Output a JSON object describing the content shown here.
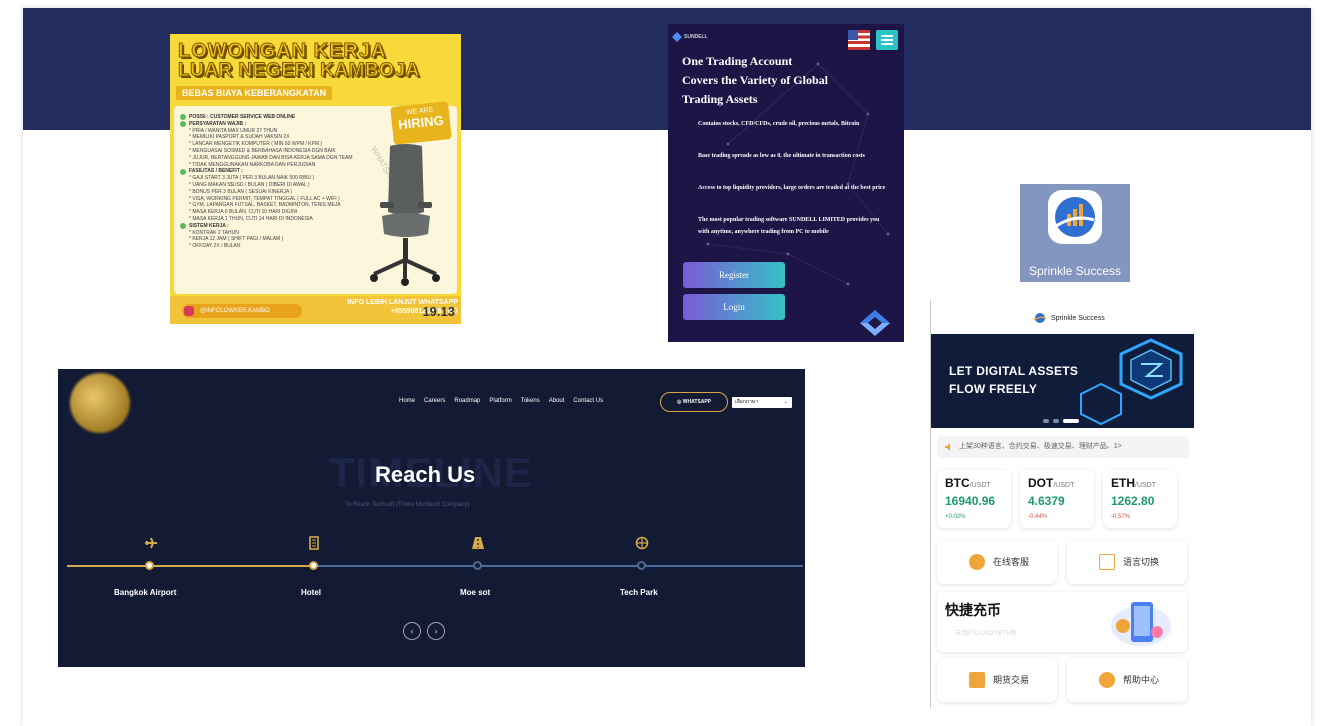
{
  "colors": {
    "band": "#222c5e",
    "poster_yellow": "#f8d93a",
    "trade_bg": "#1c1546",
    "timeline_bg": "#121a34",
    "gold": "#d3a94a",
    "green": "#1c9a6b",
    "red": "#d9534f"
  },
  "poster": {
    "title_line1": "LOWONGAN KERJA",
    "title_line2": "LUAR NEGERI KAMBOJA",
    "ribbon": "BEBAS BIAYA KEBERANGKATAN",
    "hiring_small": "WE ARE",
    "hiring_big": "HIRING",
    "watermark": "WHATSAPP",
    "sections": [
      {
        "title": "POSISI : CUSTOMER SERVICE WEB ONLINE",
        "items": []
      },
      {
        "title": "PERSYARATAN WAJIB :",
        "items": [
          "* PRIA / WANITA MAX UMUR 27 THUN",
          "* MEMILIKI PASPORT & SUDAH VAKSIN 2X",
          "* LANCAR MENGETIK KOMPUTER ( MIN 60 WPM / KPM )",
          "* MENGUASAI SOSMED & BERBAHASA INDONESIA DGN BAIK",
          "* JUJUR, BERTANGGUNG JAWAB DAN BISA KERJA SAMA DGN TEAM",
          "* TIDAK MENGGUNAKAN NARKOBA DAN PERJUDIAN"
        ]
      },
      {
        "title": "FASILITAS / BENEFIT :",
        "items": [
          "* GAJI START 3 JUTA ( PER 3 BULAN NAIK 500 RIBU )",
          "* UANG MAKAN 5$USD / BULAN ( DIBERI DI AWAL )",
          "* BONUS PER 3 BULAN ( SESUAI KINERJA )",
          "* VISA, WORKING PERMIT, TEMPAT TINGGAL ( FULL AC + WIFI )",
          "* GYM, LAPANGAN FUTSAL, BASKET, BADMINTON, TENIS MEJA",
          "* MASA KERJA 6 BULAN, CUTI 10 HARI DIGINI",
          "* MASA KERJA 1 THUN, CUTI 14 HARI DI INDONESIA"
        ]
      },
      {
        "title": "SISTEM KERJA :",
        "items": [
          "* KONTRAK 2 TAHUN",
          "* KERJA 12 JAM ( SHIFT PAGI / MALAM )",
          "* OFFDAY 2X / BULAN"
        ]
      }
    ],
    "instagram": "@INFOLOWKER.KAMBO",
    "info_line1": "INFO LEBIH LANJUT WHATSAPP",
    "info_line2": "+855968126318 | RO",
    "stamp": "19.13"
  },
  "trade": {
    "brand": "SUNDELL",
    "title_lines": [
      "One Trading Account",
      "Covers the Variety of Global",
      "Trading Assets"
    ],
    "paragraphs": [
      "Contains stocks, CFD/CFDs, crude oil, precious metals, Bitcoin",
      "Base trading spreads as low as 0, the ultimate in transaction costs",
      "Access to top liquidity providers, large orders are traded at the best price",
      "The most popular trading software SUNDELL LIMITED provides you with anytime, anywhere trading from PC to mobile"
    ],
    "register": "Register",
    "login": "Login"
  },
  "sprinkle_icon": {
    "label": "Sprinkle Success"
  },
  "sprinkle": {
    "header": "Sprinkle Success",
    "banner_line1": "LET DIGITAL ASSETS",
    "banner_line2": "FLOW FREELY",
    "announcement": "上架30种语言、合约交易、极速交易、理财产品、1>",
    "tickers": [
      {
        "symbol": "BTC",
        "quote": "/USDT",
        "price": "16940.96",
        "change": "+0.02%"
      },
      {
        "symbol": "DOT",
        "quote": "/USDT",
        "price": "4.6379",
        "change": "-0.44%"
      },
      {
        "symbol": "ETH",
        "quote": "/USDT",
        "price": "1262.80",
        "change": "-0.57%"
      }
    ],
    "tiles": [
      {
        "label": "在线客服"
      },
      {
        "label": "语言切换"
      },
      {
        "label": "期货交易"
      },
      {
        "label": "帮助中心"
      }
    ],
    "quick_title": "快捷充币",
    "quick_sub": "支持BTC/USDT/ETH等"
  },
  "timeline": {
    "nav": [
      "Home",
      "Careers",
      "Roadmap",
      "Platform",
      "Tokens",
      "About",
      "Contact Us"
    ],
    "whatsapp": "◎ WHATSAPP",
    "language": "เลือกภาษา",
    "ghost": "TIMELINE",
    "heading": "Reach Us",
    "subheading": "To Reach Techsoft (Trinnx Multitech Company)",
    "stops": [
      {
        "label": "Bangkok Airport",
        "icon": "plane-icon"
      },
      {
        "label": "Hotel",
        "icon": "building-icon"
      },
      {
        "label": "Moe sot",
        "icon": "road-icon"
      },
      {
        "label": "Tech Park",
        "icon": "globe-icon"
      }
    ]
  }
}
